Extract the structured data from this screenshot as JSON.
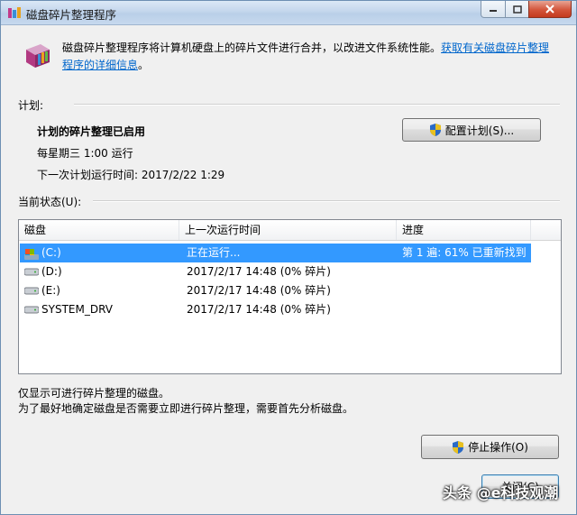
{
  "window": {
    "title": "磁盘碎片整理程序"
  },
  "intro": {
    "text": "磁盘碎片整理程序将计算机硬盘上的碎片文件进行合并，以改进文件系统性能。",
    "link": "获取有关磁盘碎片整理程序的详细信息",
    "trailing": "。"
  },
  "schedule": {
    "label": "计划:",
    "status": "计划的碎片整理已启用",
    "frequency": "每星期三  1:00 运行",
    "next_run": "下一次计划运行时间: 2017/2/22 1:29",
    "configure_button": "配置计划(S)..."
  },
  "current": {
    "label": "当前状态(U):",
    "columns": [
      "磁盘",
      "上一次运行时间",
      "进度"
    ],
    "rows": [
      {
        "disk": "(C:)",
        "last_run": "正在运行...",
        "progress": "第 1 遍: 61% 已重新找到",
        "selected": true
      },
      {
        "disk": "(D:)",
        "last_run": "2017/2/17 14:48 (0% 碎片)",
        "progress": "",
        "selected": false
      },
      {
        "disk": "(E:)",
        "last_run": "2017/2/17 14:48 (0% 碎片)",
        "progress": "",
        "selected": false
      },
      {
        "disk": "SYSTEM_DRV",
        "last_run": "2017/2/17 14:48 (0% 碎片)",
        "progress": "",
        "selected": false
      }
    ]
  },
  "notes": {
    "line1": "仅显示可进行碎片整理的磁盘。",
    "line2": "为了最好地确定磁盘是否需要立即进行碎片整理，需要首先分析磁盘。"
  },
  "buttons": {
    "stop": "停止操作(O)",
    "close": "关闭(C)"
  },
  "watermark": "头条 @e科技观潮",
  "colors": {
    "selection": "#3399ff",
    "link": "#0066cc"
  }
}
